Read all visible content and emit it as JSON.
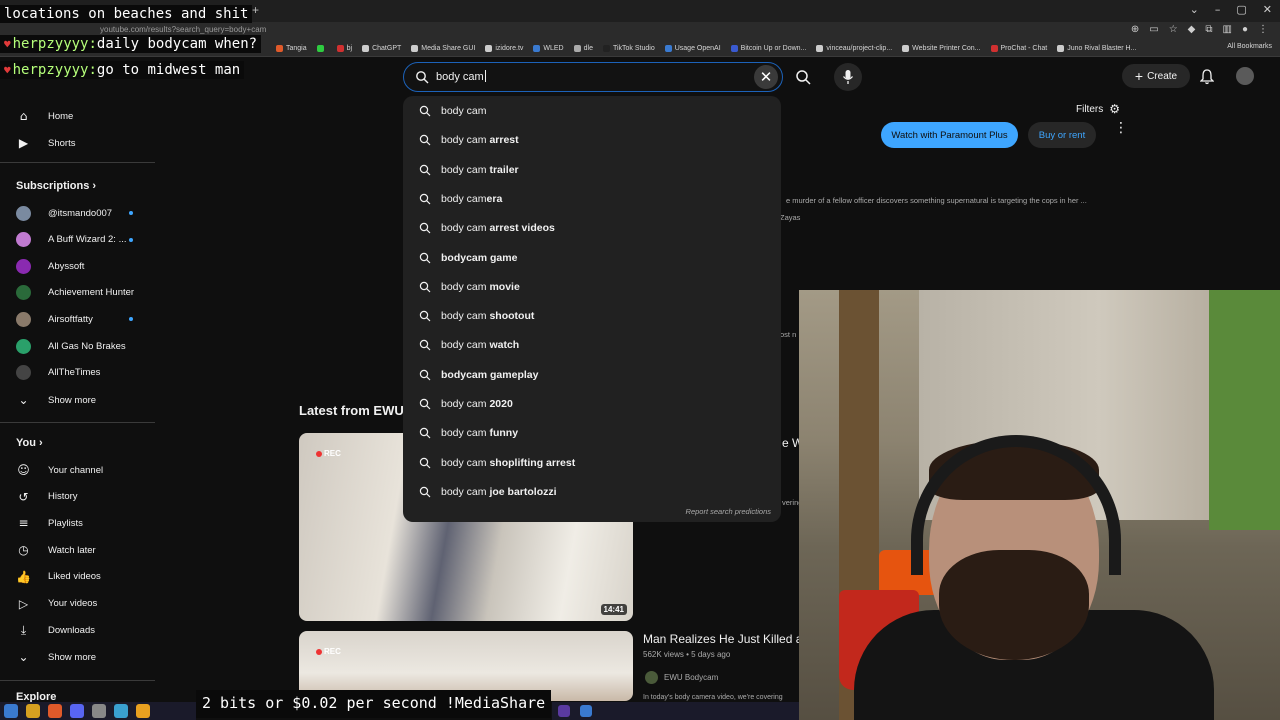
{
  "browser": {
    "url": "youtube.com/results?search_query=body+cam",
    "window_controls": [
      "⌄",
      "–",
      "▢",
      "✕"
    ],
    "new_tab": "+",
    "bookmarks": [
      {
        "label": "Tangia",
        "color": "#e05a2a"
      },
      {
        "label": "",
        "color": "#2ecc40"
      },
      {
        "label": "bj",
        "color": "#d03030"
      },
      {
        "label": "ChatGPT",
        "color": "#cccccc"
      },
      {
        "label": "Media Share GUI",
        "color": "#cccccc"
      },
      {
        "label": "izidore.tv",
        "color": "#cccccc"
      },
      {
        "label": "WLED",
        "color": "#3a7ad0"
      },
      {
        "label": "dle",
        "color": "#aaaaaa"
      },
      {
        "label": "TikTok Studio",
        "color": "#222222"
      },
      {
        "label": "Usage OpenAI",
        "color": "#3a7ad0"
      },
      {
        "label": "Bitcoin Up or Down...",
        "color": "#3a5ad0"
      },
      {
        "label": "vinceau/project-clip...",
        "color": "#cccccc"
      },
      {
        "label": "Website Printer Con...",
        "color": "#cccccc"
      },
      {
        "label": "ProChat - Chat",
        "color": "#d03030"
      },
      {
        "label": "Juno Rival Blaster H...",
        "color": "#cccccc"
      }
    ],
    "all_bookmarks": "All Bookmarks"
  },
  "chat_overlays": [
    {
      "user": "",
      "text": "locations on beaches and shit"
    },
    {
      "user": "herpzyyyy:",
      "text": "daily bodycam when?"
    },
    {
      "user": "herpzyyyy:",
      "text": "go to midwest man"
    }
  ],
  "search": {
    "query": "body cam",
    "clear_icon": "✕"
  },
  "header": {
    "create_label": "Create"
  },
  "suggestions": [
    {
      "base": "body cam",
      "rest": ""
    },
    {
      "base": "body cam ",
      "rest": "arrest"
    },
    {
      "base": "body cam ",
      "rest": "trailer"
    },
    {
      "base": "body cam",
      "rest": "era"
    },
    {
      "base": "body cam ",
      "rest": "arrest videos"
    },
    {
      "base": "",
      "rest": "bodycam game"
    },
    {
      "base": "body cam ",
      "rest": "movie"
    },
    {
      "base": "body cam ",
      "rest": "shootout"
    },
    {
      "base": "body cam ",
      "rest": "watch"
    },
    {
      "base": "",
      "rest": "bodycam gameplay"
    },
    {
      "base": "body cam ",
      "rest": "2020"
    },
    {
      "base": "body cam ",
      "rest": "funny"
    },
    {
      "base": "body cam ",
      "rest": "shoplifting arrest"
    },
    {
      "base": "body cam ",
      "rest": "joe bartolozzi"
    }
  ],
  "report_label": "Report search predictions",
  "sidebar": {
    "top": [
      {
        "label": "Home",
        "icon": "⌂"
      },
      {
        "label": "Shorts",
        "icon": "▶"
      }
    ],
    "subscriptions_title": "Subscriptions",
    "subscriptions": [
      {
        "label": "@itsmando007",
        "color": "#7a8aa0",
        "live": true
      },
      {
        "label": "A Buff Wizard 2: ...",
        "color": "#c07ad0",
        "live": true
      },
      {
        "label": "Abyssoft",
        "color": "#8a2ab0",
        "live": false
      },
      {
        "label": "Achievement Hunter",
        "color": "#2a6a3a",
        "live": false
      },
      {
        "label": "Airsoftfatty",
        "color": "#8a7a6a",
        "live": true
      },
      {
        "label": "All Gas No Brakes",
        "color": "#2aa06a",
        "live": false
      },
      {
        "label": "AllTheTimes",
        "color": "#444444",
        "live": false
      }
    ],
    "show_more": "Show more",
    "you_title": "You",
    "you_items": [
      {
        "label": "Your channel",
        "icon": "☺"
      },
      {
        "label": "History",
        "icon": "↺"
      },
      {
        "label": "Playlists",
        "icon": "≡"
      },
      {
        "label": "Watch later",
        "icon": "◷"
      },
      {
        "label": "Liked videos",
        "icon": "👍"
      },
      {
        "label": "Your videos",
        "icon": "▷"
      },
      {
        "label": "Downloads",
        "icon": "⤓"
      }
    ],
    "show_more_2": "Show more",
    "explore_title": "Explore"
  },
  "main": {
    "filters_label": "Filters",
    "paramount_label": "Watch with Paramount Plus",
    "buy_rent_label": "Buy or rent",
    "movie_desc": "e murder of a fellow officer discovers something supernatural is targeting the cops in her ...",
    "movie_cast": "Zayas",
    "frag_most": "ost n",
    "latest_title": "Latest from EWU",
    "video1": {
      "rec": "REC",
      "duration": "14:41"
    },
    "frag_w": "e W",
    "frag_vering": "vering",
    "video2": {
      "rec": "REC",
      "title": "Man Realizes He Just Killed a",
      "meta": "562K views • 5 days ago",
      "channel": "EWU Bodycam",
      "desc": "In today's body camera video, we're covering"
    }
  },
  "ticker": "2 bits or $0.02 per second !MediaShare",
  "colors": {
    "accent": "#3ea6ff",
    "search_border": "#1c62b9",
    "background": "#0f0f0f",
    "dropdown_bg": "#212121",
    "live_dot": "#3ea6ff"
  }
}
